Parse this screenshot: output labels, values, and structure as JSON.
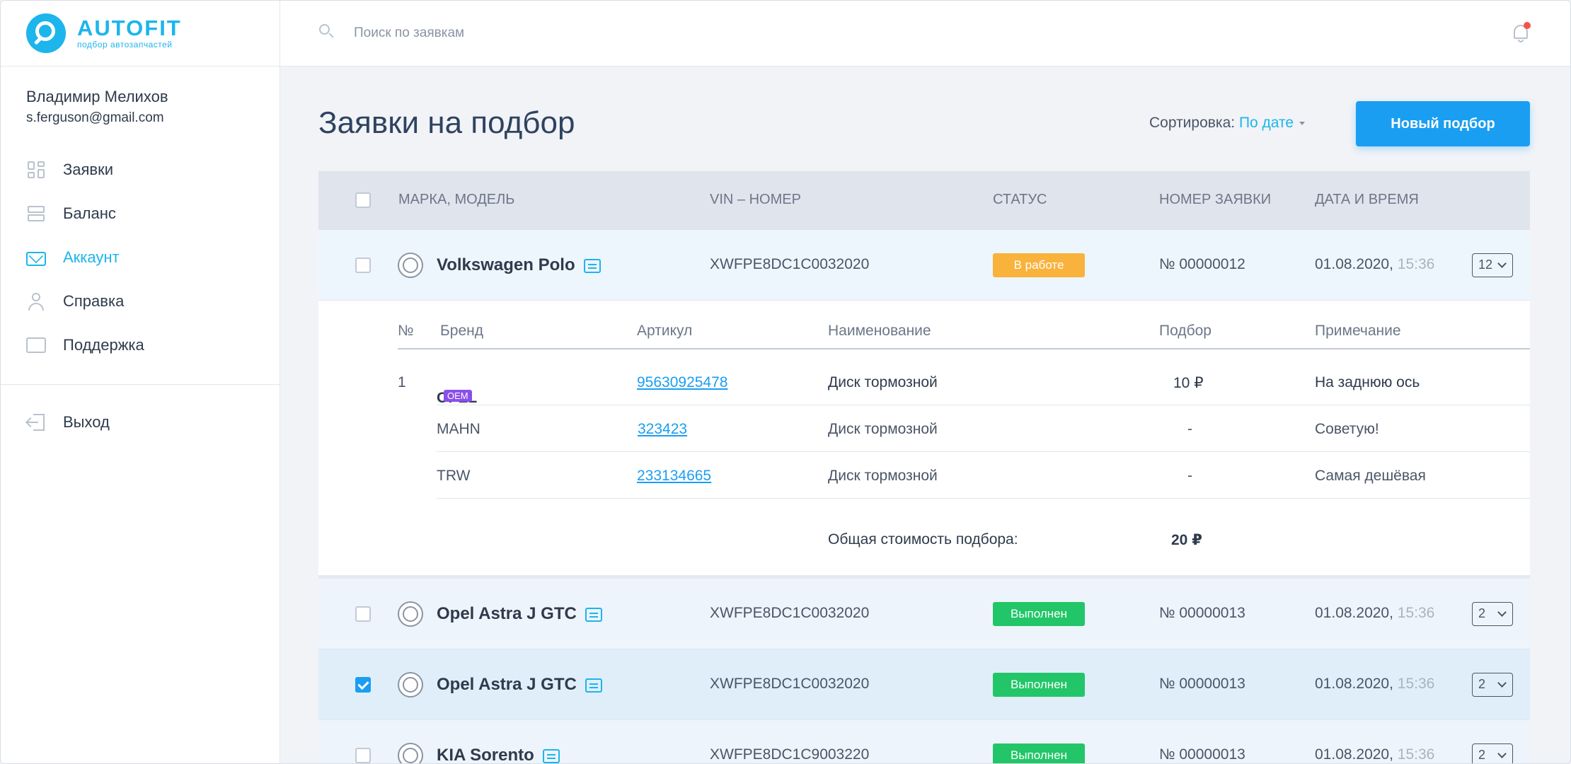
{
  "brand": {
    "title": "AUTOFIT",
    "subtitle": "подбор автозапчастей"
  },
  "user": {
    "name": "Владимир Мелихов",
    "email": "s.ferguson@gmail.com"
  },
  "menu": [
    {
      "label": "Заявки",
      "icon": "grid-icon"
    },
    {
      "label": "Баланс",
      "icon": "stack-icon"
    },
    {
      "label": "Аккаунт",
      "icon": "mail-icon",
      "active": true
    },
    {
      "label": "Справка",
      "icon": "user-icon"
    },
    {
      "label": "Поддержка",
      "icon": "chat-icon"
    }
  ],
  "exit_label": "Выход",
  "search": {
    "placeholder": "Поиск по заявкам"
  },
  "page": {
    "title": "Заявки на подбор",
    "sort_label": "Сортировка:",
    "sort_value": "По дате",
    "new_button": "Новый подбор"
  },
  "columns": {
    "model": "МАРКА, МОДЕЛЬ",
    "vin": "VIN – НОМЕР",
    "status": "СТАТУС",
    "number": "НОМЕР ЗАЯВКИ",
    "datetime": "ДАТА И ВРЕМЯ"
  },
  "rows": [
    {
      "car": "Volkswagen Polo",
      "vin": "XWFPE8DC1C0032020",
      "status": "В работе",
      "number": "№ 00000012",
      "date": "01.08.2020,",
      "time": "15:36",
      "count": "12",
      "checked": false
    },
    {
      "car": "Opel Astra J GTC",
      "vin": "XWFPE8DC1C0032020",
      "status": "Выполнен",
      "number": "№ 00000013",
      "date": "01.08.2020,",
      "time": "15:36",
      "count": "2",
      "checked": false
    },
    {
      "car": "Opel Astra J GTC",
      "vin": "XWFPE8DC1C0032020",
      "status": "Выполнен",
      "number": "№ 00000013",
      "date": "01.08.2020,",
      "time": "15:36",
      "count": "2",
      "checked": true
    },
    {
      "car": "KIA Sorento",
      "vin": "XWFPE8DC1C9003220",
      "status": "Выполнен",
      "number": "№ 00000013",
      "date": "01.08.2020,",
      "time": "15:36",
      "count": "2",
      "checked": false
    }
  ],
  "details": {
    "columns": {
      "no": "№",
      "brand": "Бренд",
      "article": "Артикул",
      "name": "Наименование",
      "pick": "Подбор",
      "note": "Примечание"
    },
    "items": [
      {
        "no": "1",
        "brand": "OPEL",
        "badge": "OEM",
        "article": "95630925478",
        "name": "Диск тормозной",
        "price": "10 ₽",
        "note": "На заднюю ось"
      },
      {
        "no": "",
        "brand": "MAHN",
        "badge": "",
        "article": "323423",
        "name": "Диск тормозной",
        "price": "-",
        "note": "Советую!"
      },
      {
        "no": "",
        "brand": "TRW",
        "badge": "",
        "article": "233134665",
        "name": "Диск тормозной",
        "price": "-",
        "note": "Самая дешёвая"
      }
    ],
    "total_label": "Общая стоимость подбора:",
    "total_value": "20 ₽"
  },
  "colors": {
    "accent": "#1cb5ec",
    "button": "#1a9ef2",
    "in_work": "#f9b23c",
    "done": "#22c668",
    "oem": "#8a4fea"
  }
}
